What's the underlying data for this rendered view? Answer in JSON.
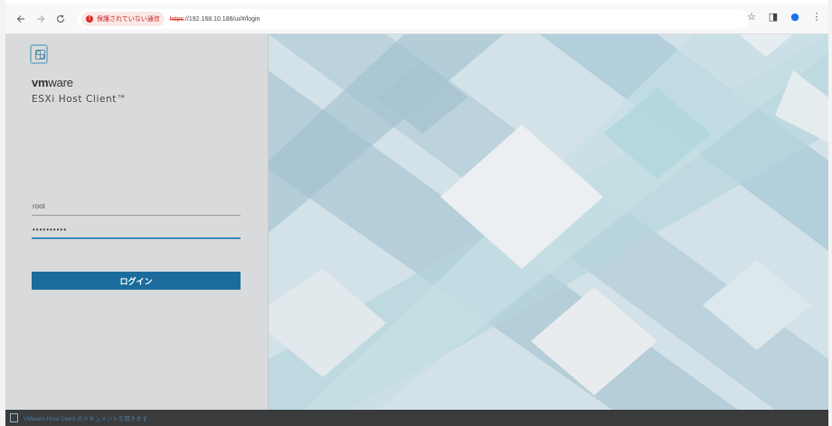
{
  "browser": {
    "back_icon": "arrow-left-icon",
    "forward_icon": "arrow-right-icon",
    "reload_icon": "reload-icon",
    "security_label": "保護されていない通信",
    "url_scheme": "https",
    "url_rest": "://192.168.10.186/ui/#/login",
    "star_icon": "star-icon",
    "sidepanel_icon": "side-panel-icon",
    "profile_icon": "profile-icon",
    "menu_icon": "more-vert-icon"
  },
  "login": {
    "brand_bold": "vm",
    "brand_rest": "ware",
    "product_name": "ESXi Host Client™",
    "username_value": "root",
    "password_value": "••••••••••",
    "login_label": "ログイン"
  },
  "footer": {
    "doc_link": "VMware Host Client のドキュメントを開きます"
  },
  "colors": {
    "panel": "#d9dadb",
    "button": "#1b6c9c",
    "password_underline": "#3a88b8",
    "footer": "#3a3b3c"
  }
}
